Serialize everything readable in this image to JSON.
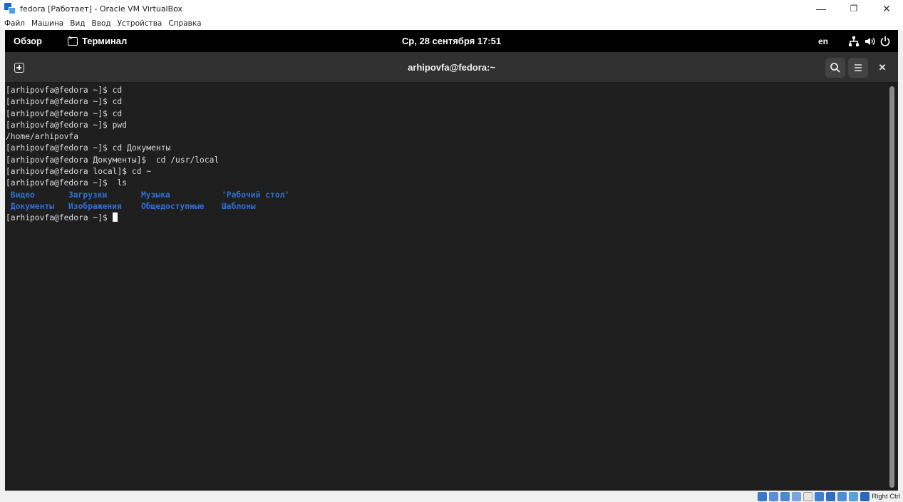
{
  "host": {
    "title": "fedora [Работает] - Oracle VM VirtualBox",
    "menu": [
      "Файл",
      "Машина",
      "Вид",
      "Ввод",
      "Устройства",
      "Справка"
    ],
    "controls": {
      "minimize": "—",
      "restore": "❐",
      "close": "✕"
    },
    "status": {
      "host_key": "Right Ctrl"
    }
  },
  "gnome": {
    "activities": "Обзор",
    "app_name": "Терминал",
    "clock": "Ср, 28 сентября  17:51",
    "lang": "en"
  },
  "terminal": {
    "title": "arhipovfa@fedora:~",
    "lines": [
      "[arhipovfa@fedora ~]$ cd",
      "[arhipovfa@fedora ~]$ cd",
      "[arhipovfa@fedora ~]$ cd",
      "[arhipovfa@fedora ~]$ pwd",
      "/home/arhipovfa",
      "[arhipovfa@fedora ~]$ cd Документы",
      "[arhipovfa@fedora Документы]$  cd /usr/local",
      "[arhipovfa@fedora local]$ cd ~",
      "[arhipovfa@fedora ~]$  ls"
    ],
    "ls_rows": [
      [
        " Видео",
        "Загрузки",
        "Музыка",
        "'Рабочий стол'"
      ],
      [
        " Документы",
        "Изображения",
        "Общедоступные",
        "Шаблоны"
      ]
    ],
    "prompt": "[arhipovfa@fedora ~]$ "
  },
  "colors": {
    "terminal_bg": "#1e1e1e",
    "header_bg": "#303030",
    "gnome_bar_bg": "#000000",
    "directory_blue": "#2f6fd3"
  },
  "icons": {
    "new_tab": "new-tab-icon",
    "search": "search-icon",
    "menu": "hamburger-menu-icon",
    "close": "close-icon",
    "network": "network-icon",
    "volume": "volume-icon",
    "power": "power-icon"
  }
}
